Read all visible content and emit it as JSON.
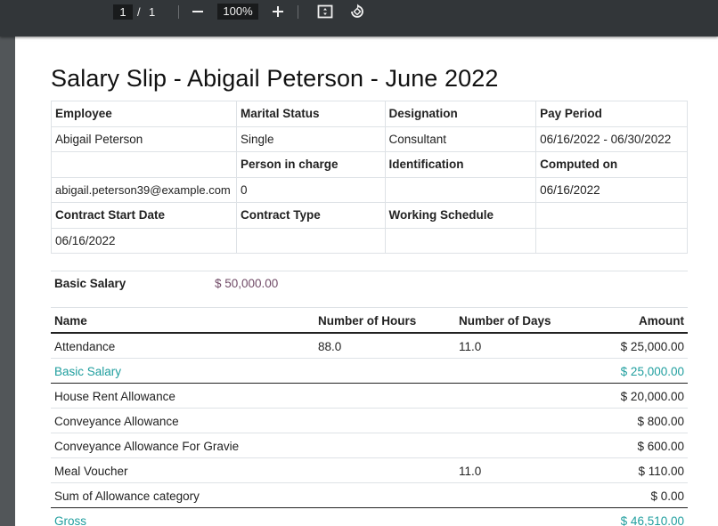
{
  "toolbar": {
    "current_page": "1",
    "separator": "/",
    "total_pages": "1",
    "zoom": "100%"
  },
  "slip": {
    "title": "Salary Slip - Abigail Peterson - June 2022",
    "labels": {
      "employee": "Employee",
      "marital_status": "Marital Status",
      "designation": "Designation",
      "pay_period": "Pay Period",
      "person_in_charge": "Person in charge",
      "identification": "Identification",
      "computed_on": "Computed on",
      "contract_start_date": "Contract Start Date",
      "contract_type": "Contract Type",
      "working_schedule": "Working Schedule"
    },
    "values": {
      "employee": "Abigail Peterson",
      "marital_status": "Single",
      "designation": "Consultant",
      "pay_period": "06/16/2022 - 06/30/2022",
      "email": "abigail.peterson39@example.com",
      "person_in_charge": "0",
      "identification": "",
      "computed_on": "06/16/2022",
      "contract_start_date": "06/16/2022",
      "contract_type": "",
      "working_schedule": ""
    },
    "basic_salary_label": "Basic Salary",
    "basic_salary_value": "$ 50,000.00"
  },
  "lines": {
    "headers": {
      "name": "Name",
      "hours": "Number of Hours",
      "days": "Number of Days",
      "amount": "Amount"
    },
    "rows": [
      {
        "name": "Attendance",
        "hours": "88.0",
        "days": "11.0",
        "amount": "$ 25,000.00"
      },
      {
        "name": "Basic Salary",
        "hours": "",
        "days": "",
        "amount": "$ 25,000.00"
      },
      {
        "name": "House Rent Allowance",
        "hours": "",
        "days": "",
        "amount": "$ 20,000.00"
      },
      {
        "name": "Conveyance Allowance",
        "hours": "",
        "days": "",
        "amount": "$ 800.00"
      },
      {
        "name": "Conveyance Allowance For Gravie",
        "hours": "",
        "days": "",
        "amount": "$ 600.00"
      },
      {
        "name": "Meal Voucher",
        "hours": "",
        "days": "11.0",
        "amount": "$ 110.00"
      },
      {
        "name": "Sum of Allowance category",
        "hours": "",
        "days": "",
        "amount": "$ 0.00"
      },
      {
        "name": "Gross",
        "hours": "",
        "days": "",
        "amount": "$ 46,510.00"
      }
    ]
  },
  "colors": {
    "accent_teal": "#1f9e9e",
    "currency_purple": "#714b67",
    "toolbar_bg": "#323639",
    "viewer_bg": "#525659"
  }
}
